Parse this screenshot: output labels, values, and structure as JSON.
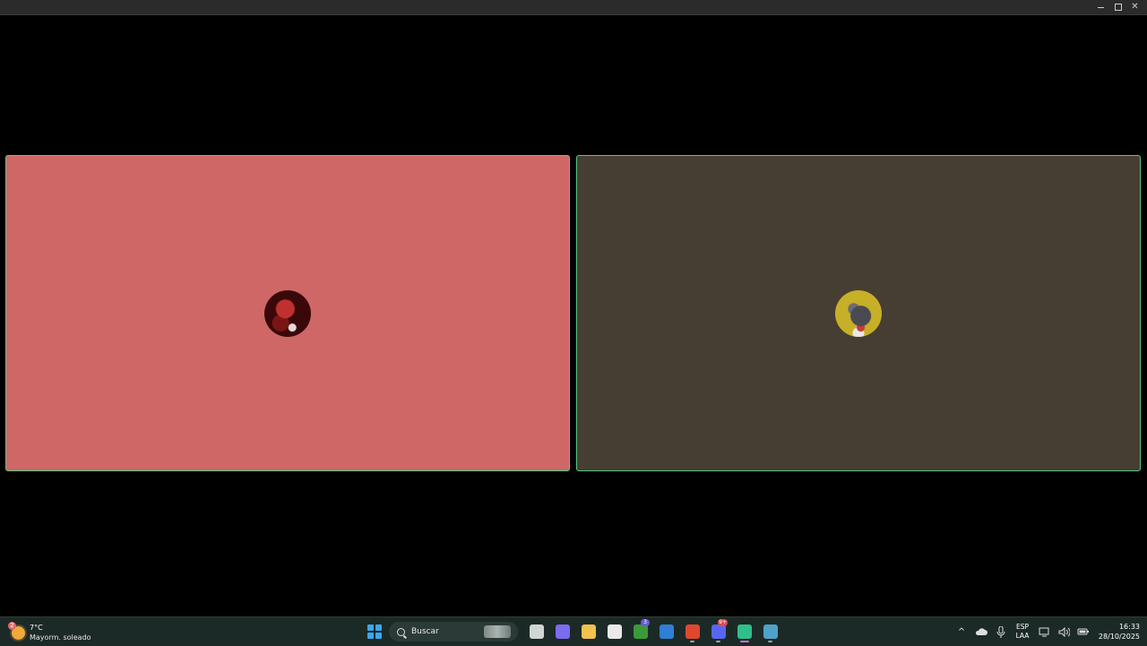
{
  "window": {
    "controls": {
      "minimize": "",
      "maximize": "",
      "close": "✕"
    }
  },
  "tiles": [
    {
      "bg": "#cf6767",
      "avatar": "red-character-avatar"
    },
    {
      "bg": "#473e33",
      "avatar": "gray-creature-avatar"
    }
  ],
  "taskbar": {
    "weather": {
      "badge": "2",
      "temp": "7°C",
      "desc": "Mayorm. soleado"
    },
    "search": {
      "label": "Buscar"
    },
    "apps": [
      {
        "name": "task-view-icon",
        "color": "#cfd6d4",
        "badge": "",
        "running": false
      },
      {
        "name": "copilot-icon",
        "color": "#7b6cf0",
        "badge": "",
        "running": false
      },
      {
        "name": "file-explorer-icon",
        "color": "#f2c14e",
        "badge": "",
        "running": false
      },
      {
        "name": "microsoft-store-icon",
        "color": "#e9e9e9",
        "badge": "",
        "running": false
      },
      {
        "name": "xbox-icon",
        "color": "#3a9a3a",
        "badge": "3",
        "running": false
      },
      {
        "name": "outlook-icon",
        "color": "#2f7fd6",
        "badge": "",
        "running": false
      },
      {
        "name": "brave-icon",
        "color": "#e0482d",
        "badge": "",
        "running": true
      },
      {
        "name": "discord-icon",
        "color": "#5865f2",
        "badge": "9+",
        "running": true
      },
      {
        "name": "meet-app-icon",
        "color": "#2fbf8a",
        "badge": "",
        "running": true,
        "active": true
      },
      {
        "name": "globe-icon",
        "color": "#4fa3c8",
        "badge": "",
        "running": true
      }
    ],
    "tray": {
      "chevron": "^",
      "lang": {
        "line1": "ESP",
        "line2": "LAA"
      },
      "time": "16:33",
      "date": "28/10/2025"
    }
  }
}
